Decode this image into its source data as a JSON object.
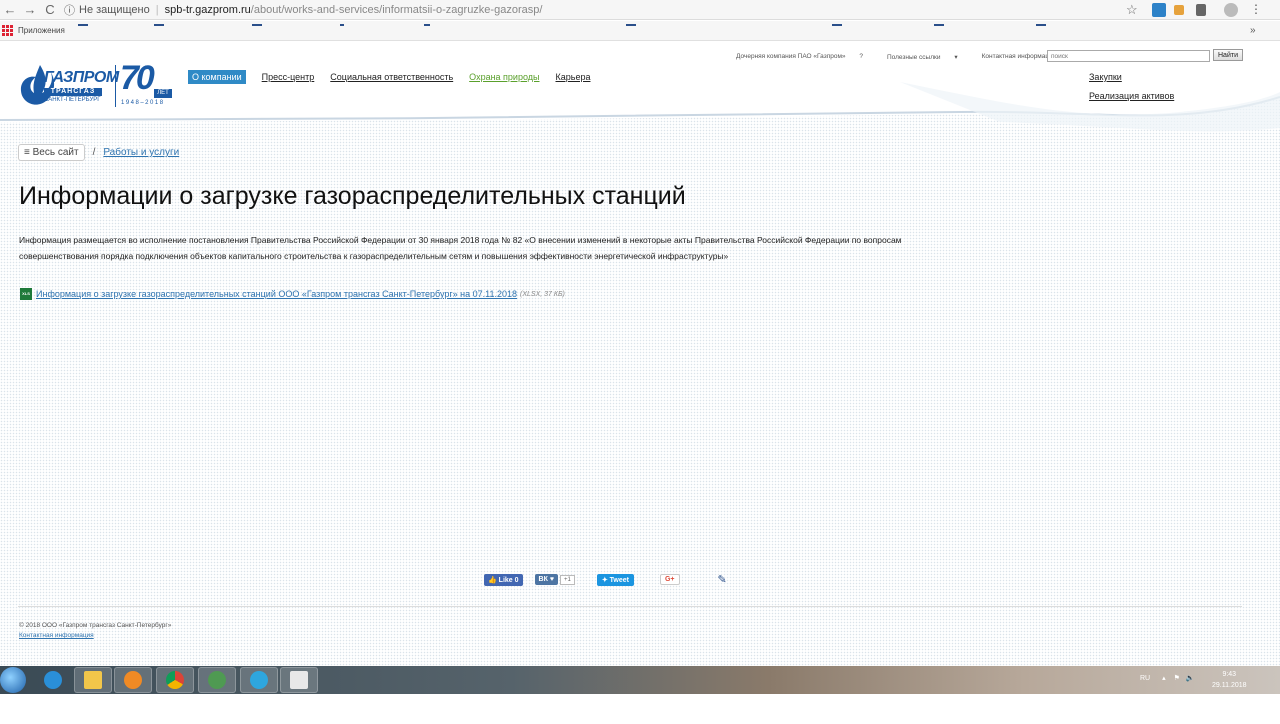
{
  "browser": {
    "insecure_label": "Не защищено",
    "url_domain": "spb-tr.gazprom.ru",
    "url_path": "/about/works-and-services/informatsii-o-zagruzke-gazorasp/",
    "apps_label": "Приложения"
  },
  "logo": {
    "brand": "ГАЗПРОМ",
    "sub1": "ТРАНСГАЗ",
    "sub2": "САНКТ-ПЕТЕРБУРГ",
    "anniversary": "70",
    "let": "ЛЕТ",
    "years": "1948–2018"
  },
  "mainnav": {
    "items": [
      {
        "label": "О компании"
      },
      {
        "label": "Пресс-центр"
      },
      {
        "label": "Социальная ответственность"
      },
      {
        "label": "Охрана природы"
      },
      {
        "label": "Карьера"
      }
    ]
  },
  "topnav": {
    "subsidiary": "Дочерняя компания ПАО «Газпром»",
    "useful_links": "Полезные ссылки",
    "contacts": "Контактная информация"
  },
  "search": {
    "placeholder": "поиск",
    "button": "Найти"
  },
  "sidelinks": {
    "items": [
      {
        "label": "Закупки"
      },
      {
        "label": "Реализация активов"
      }
    ]
  },
  "breadcrumb": {
    "all_site": "≡ Весь сайт",
    "separator": "/",
    "link": "Работы и услуги"
  },
  "page": {
    "title": "Информации о загрузке газораспределительных станций",
    "intro": "Информация размещается во исполнение постановления Правительства Российской Федерации от 30 января 2018 года № 82 «О внесении изменений в некоторые акты Правительства Российской Федерации по вопросам совершенствования порядка подключения объектов капитального строительства к газораспределительным сетям и повышения эффективности энергетической инфраструктуры»",
    "doc_link": "Информация о загрузке газораспределительных станций ООО «Газпром трансгаз Санкт-Петербург» на 07.11.2018",
    "doc_meta": "(XLSX, 37 КБ)",
    "xlsx_icon_label": "XLS"
  },
  "social": {
    "fb_like": "Like 0",
    "vk": "ВК",
    "vk_count": "+1",
    "tweet": "Tweet",
    "gplus": "G+"
  },
  "footer": {
    "copyright": "© 2018 ООО «Газпром трансгаз Санкт-Петербург»",
    "contacts": "Контактная информация"
  },
  "taskbar": {
    "lang": "RU",
    "time": "9:43",
    "date": "29.11.2018"
  },
  "colors": {
    "brand_blue": "#1b5aa5",
    "link_blue": "#2f74b0",
    "active_nav": "#2f8ac6",
    "green_nav": "#5aa02c"
  }
}
